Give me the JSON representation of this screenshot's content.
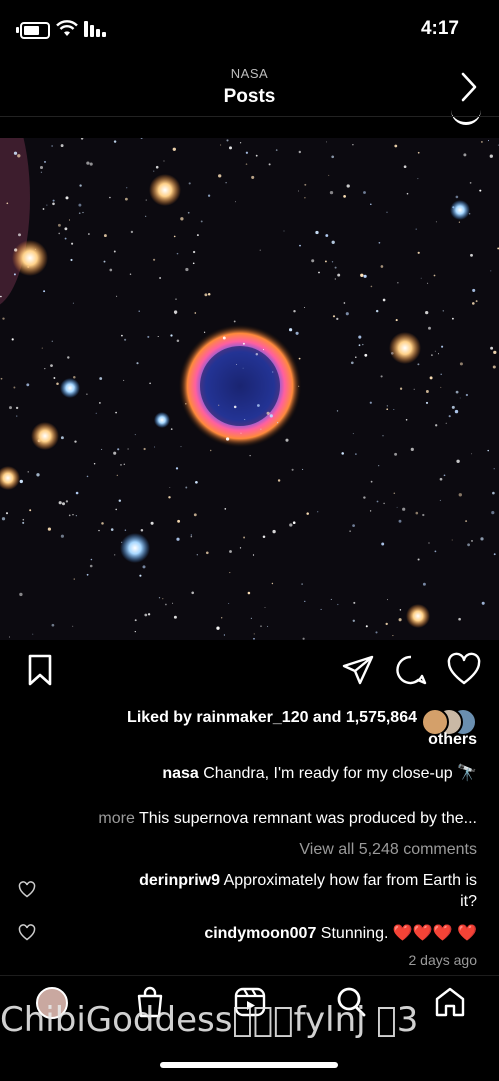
{
  "status_bar": {
    "time": "4:17"
  },
  "header": {
    "account": "NASA",
    "title": "Posts"
  },
  "post": {
    "liked_by_text": "Liked by rainmaker_120 and 1,575,864",
    "liked_by_others": "others",
    "caption_user": "nasa",
    "caption_text": "Chandra, I'm ready for my close-up",
    "caption_emoji": "🔭",
    "caption_more_text": "This supernova remnant was produced by the...",
    "more_label": "more",
    "view_comments": "View all 5,248 comments",
    "comments": [
      {
        "user": "derinpriw9",
        "text": "Approximately how far from Earth is",
        "text2": "it?"
      },
      {
        "user": "cindymoon007",
        "text": "Stunning.",
        "emoji": "❤️❤️❤️ ❤️"
      }
    ],
    "time_ago": "2 days ago"
  },
  "bottom_nav": {
    "overlay_text": "ChibiGoddess\u0000\u0000\u0000fylnj \u00003"
  },
  "colors": {
    "background": "#000000",
    "muted": "#9a9a9a"
  }
}
